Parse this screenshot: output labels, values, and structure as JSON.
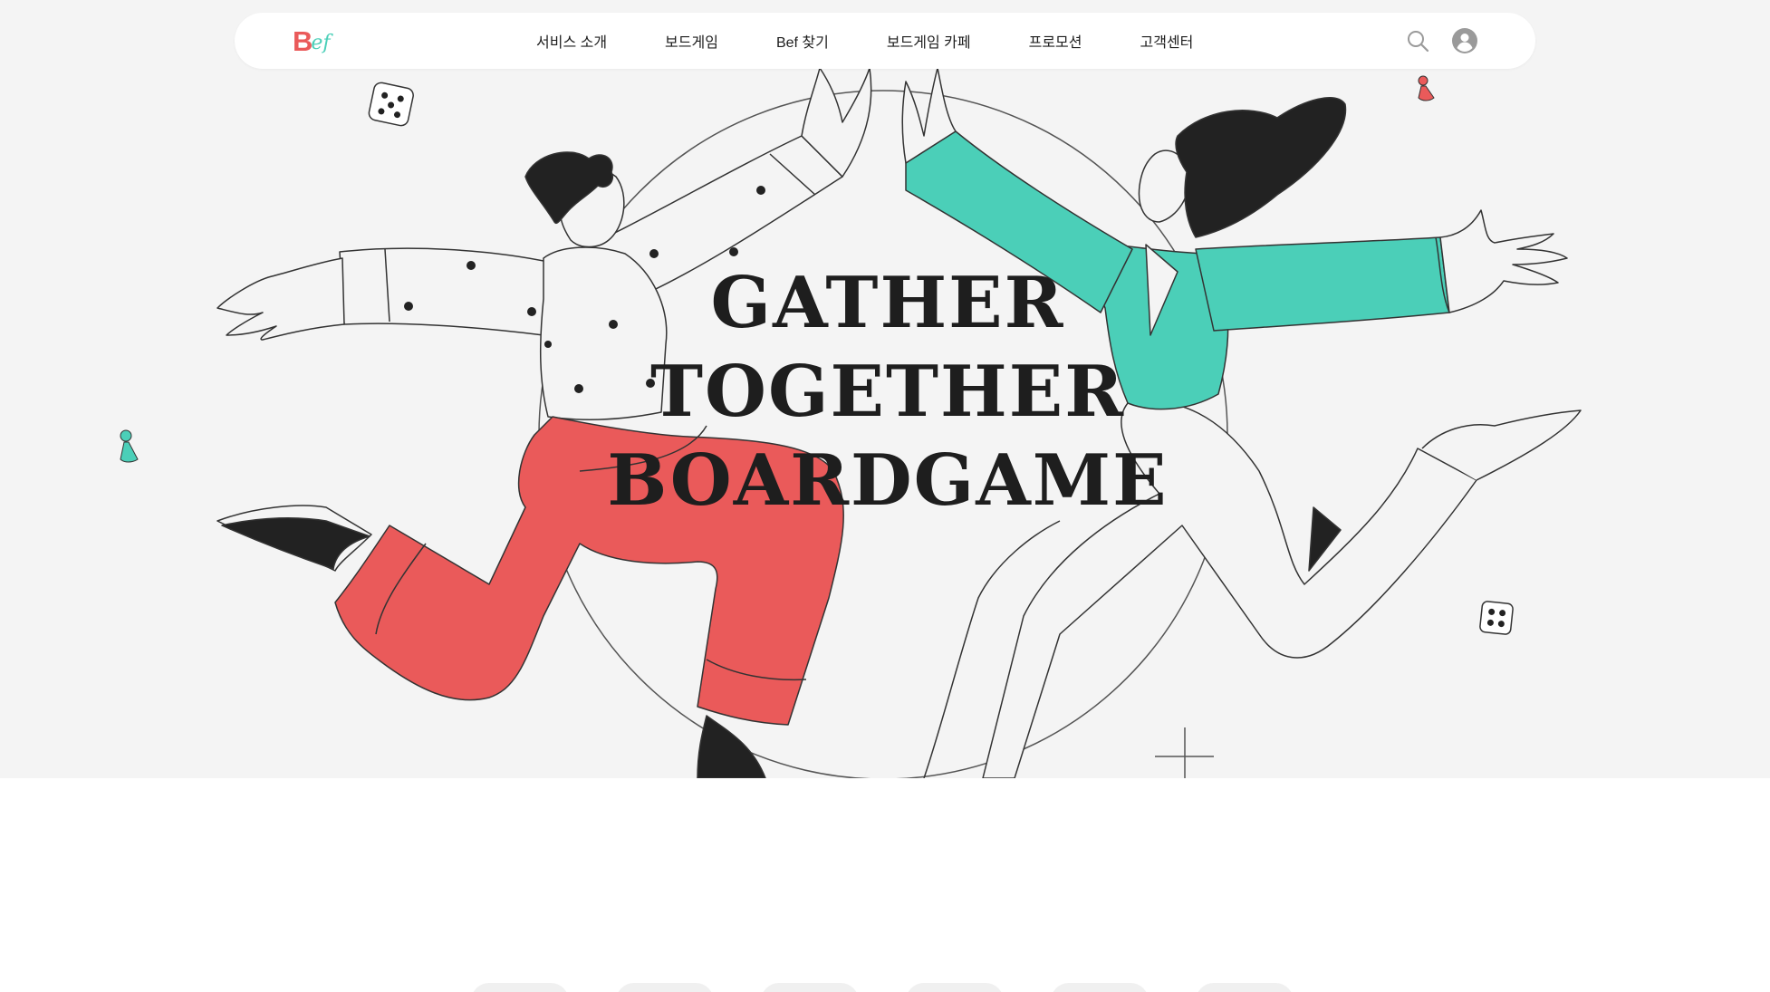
{
  "brand": {
    "logo_initial": "B",
    "logo_suffix": "ef",
    "colors": {
      "red": "#ea5a5a",
      "teal": "#4bcfb8",
      "dark": "#222222"
    }
  },
  "nav": {
    "items": [
      {
        "label": "서비스 소개"
      },
      {
        "label": "보드게임"
      },
      {
        "label": "Bef 찾기"
      },
      {
        "label": "보드게임 카페"
      },
      {
        "label": "프로모션"
      },
      {
        "label": "고객센터"
      }
    ],
    "icons": [
      "search-icon",
      "user-avatar-icon"
    ]
  },
  "hero": {
    "title_lines": [
      "GATHER",
      "TOGETHER",
      "BOARDGAME"
    ],
    "background": "#f4f4f4"
  }
}
